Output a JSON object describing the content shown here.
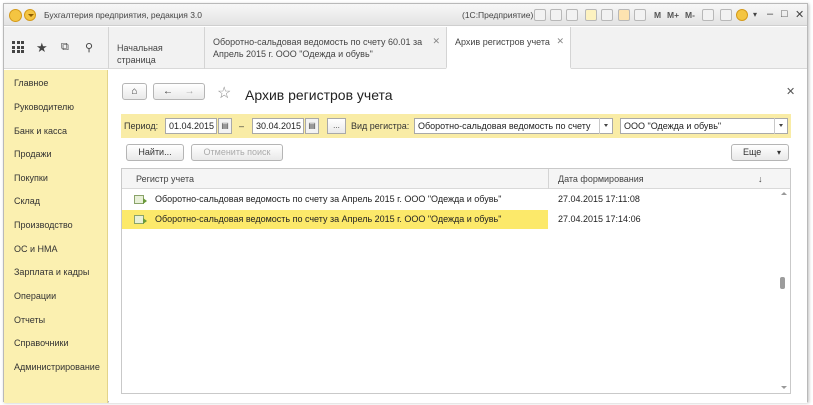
{
  "window": {
    "title": "Бухгалтерия предприятия, редакция 3.0",
    "app_name": "(1С:Предприятие)",
    "mem_buttons": [
      "M",
      "M+",
      "M-"
    ]
  },
  "tabs": [
    {
      "label": "Начальная страница"
    },
    {
      "label": "Оборотно-сальдовая ведомость по счету 60.01 за Апрель 2015 г. ООО \"Одежда и обувь\""
    },
    {
      "label": "Архив регистров учета",
      "active": true
    }
  ],
  "sidebar": {
    "items": [
      {
        "label": "Главное"
      },
      {
        "label": "Руководителю"
      },
      {
        "label": "Банк и касса"
      },
      {
        "label": "Продажи"
      },
      {
        "label": "Покупки"
      },
      {
        "label": "Склад"
      },
      {
        "label": "Производство"
      },
      {
        "label": "ОС и НМА"
      },
      {
        "label": "Зарплата и кадры"
      },
      {
        "label": "Операции"
      },
      {
        "label": "Отчеты"
      },
      {
        "label": "Справочники"
      },
      {
        "label": "Администрирование"
      }
    ]
  },
  "page": {
    "title": "Архив регистров учета"
  },
  "filters": {
    "period_label": "Период:",
    "date_from": "01.04.2015",
    "dash": "–",
    "date_to": "30.04.2015",
    "ellipsis_label": "...",
    "register_label": "Вид регистра:",
    "register_value": "Оборотно-сальдовая ведомость по счету",
    "org_value": "ООО \"Одежда и обувь\""
  },
  "actions": {
    "find": "Найти...",
    "cancel_search": "Отменить поиск",
    "more": "Еще"
  },
  "table": {
    "columns": [
      "Регистр учета",
      "Дата формирования"
    ],
    "sort_indicator": "↓",
    "rows": [
      {
        "register": "Оборотно-сальдовая ведомость по счету за Апрель 2015 г. ООО \"Одежда и обувь\"",
        "date": "27.04.2015 17:11:08",
        "selected": false
      },
      {
        "register": "Оборотно-сальдовая ведомость по счету за Апрель 2015 г. ООО \"Одежда и обувь\"",
        "date": "27.04.2015 17:14:06",
        "selected": true
      }
    ]
  }
}
